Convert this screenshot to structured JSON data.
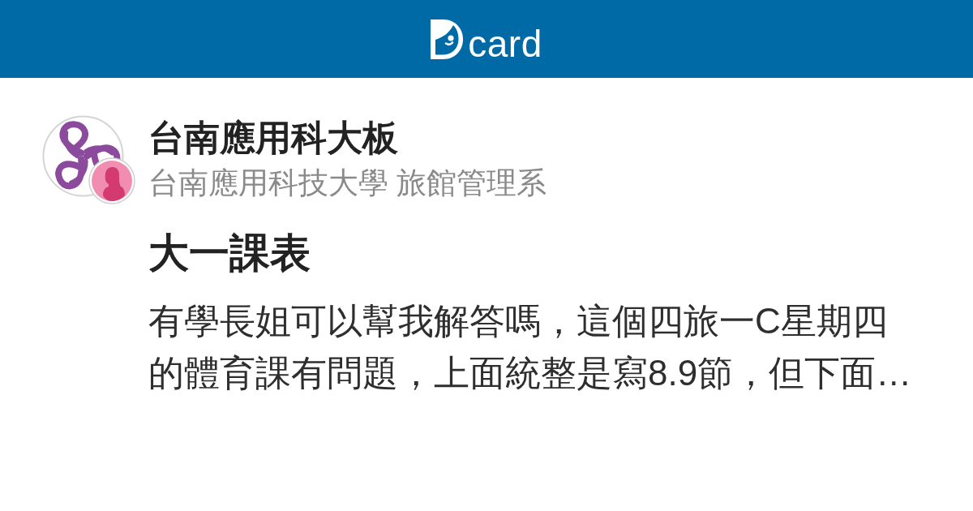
{
  "header": {
    "logo_text": "card"
  },
  "forum": {
    "name": "台南應用科大板",
    "author_affiliation": "台南應用科技大學 旅館管理系"
  },
  "author": {
    "kind": "female"
  },
  "post": {
    "title": "大一課表",
    "excerpt": "有學長姐可以幫我解答嗎，這個四旅一C星期四的體育課有問題，上面統整是寫8.9節，但下面…"
  }
}
